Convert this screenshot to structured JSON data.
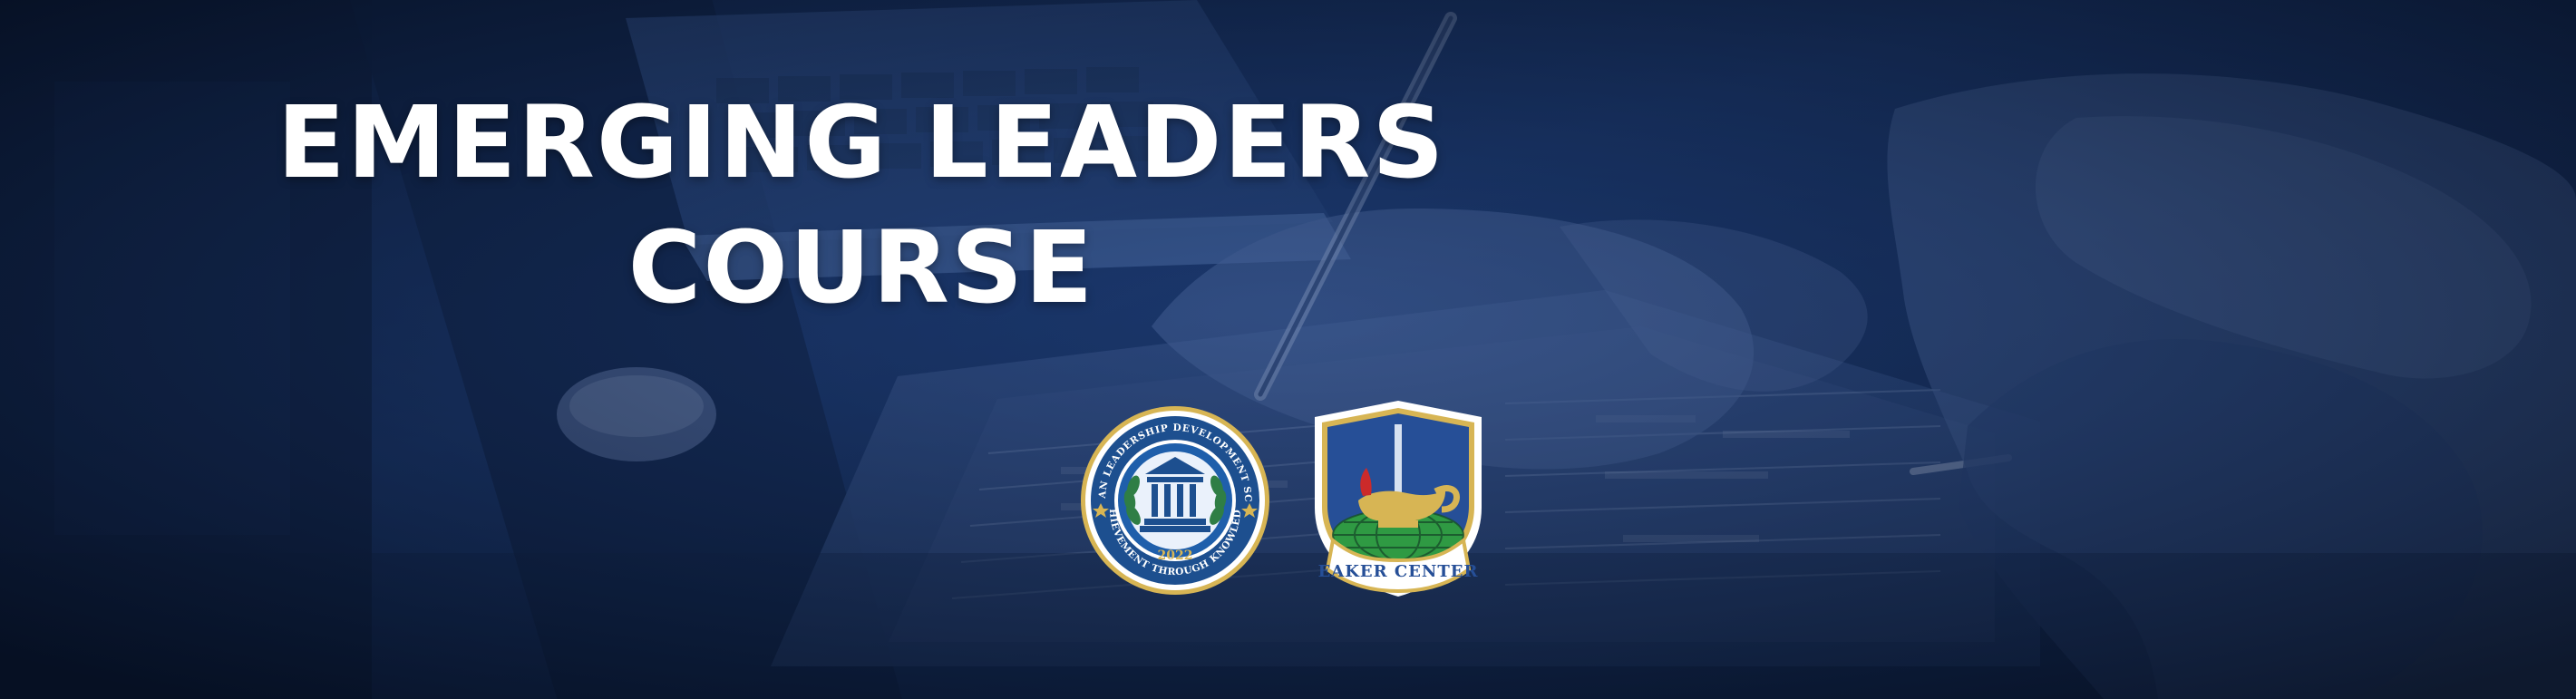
{
  "banner": {
    "title_line1": "EMERGING LEADERS",
    "title_line2": "COURSE"
  },
  "logos": {
    "seal": {
      "top_text": "CIVILIAN LEADERSHIP DEVELOPMENT SCHOOL",
      "bottom_text": "ACHIEVEMENT THROUGH KNOWLEDGE",
      "year": "2022"
    },
    "shield": {
      "name": "EAKER CENTER"
    }
  },
  "colors": {
    "background": "#0f2449",
    "title": "#ffffff",
    "seal_ring": "#1d4f8f",
    "seal_gold": "#d7b554",
    "shield_blue": "#264f97",
    "shield_green": "#2f9a43"
  },
  "icons": [
    "laptop-icon",
    "notebook-icon",
    "pen-icon",
    "building-icon",
    "lamp-icon",
    "sword-icon",
    "globe-icon"
  ]
}
